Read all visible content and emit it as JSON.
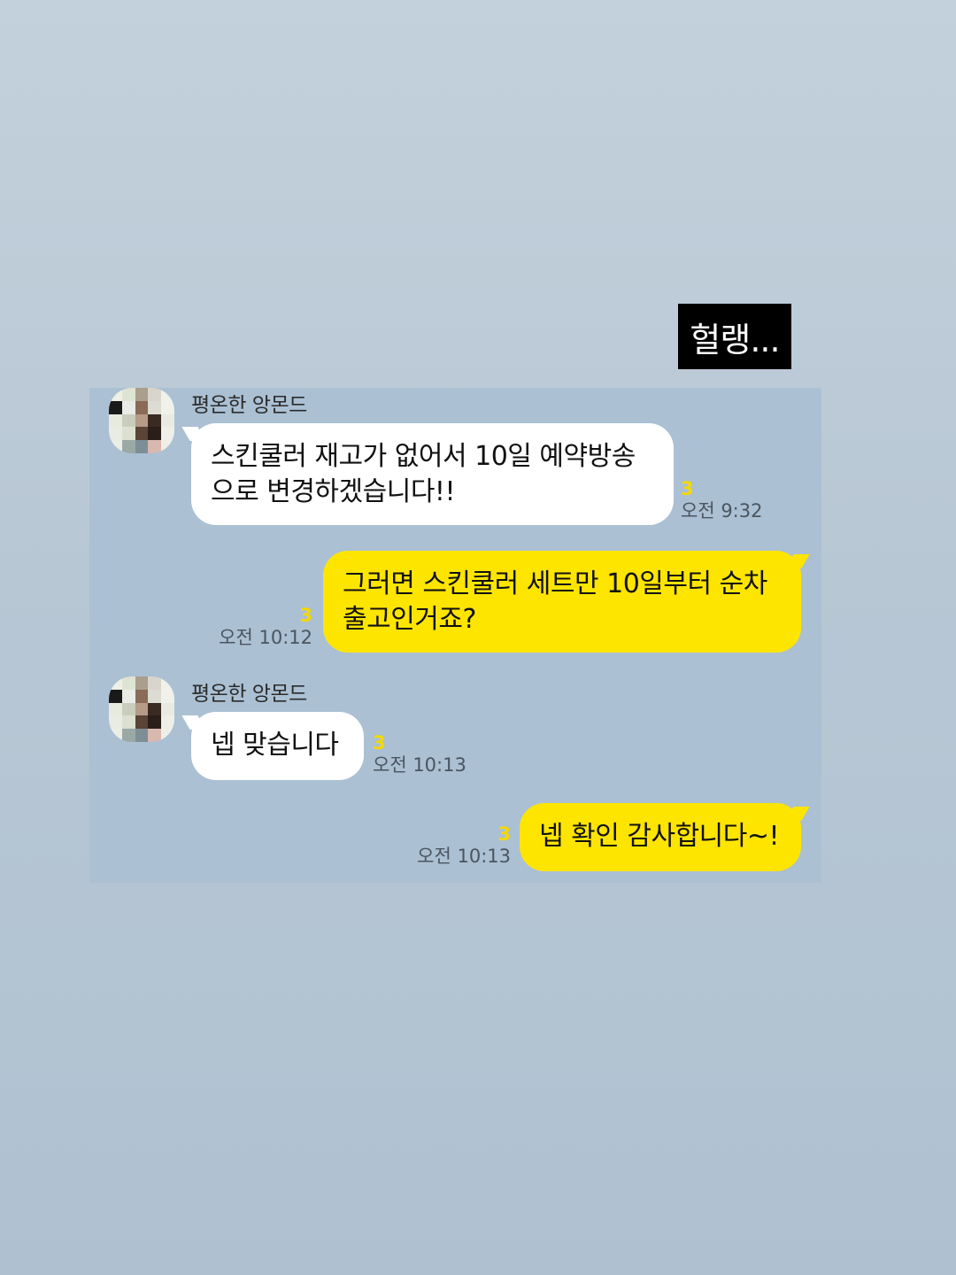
{
  "caption": "헐랭...",
  "colors": {
    "incoming_bubble": "#ffffff",
    "outgoing_bubble": "#fee500",
    "unread_count": "#f5d800",
    "chat_background": "#abc0d3"
  },
  "messages": [
    {
      "direction": "incoming",
      "sender": "평온한 앙몬드",
      "text": "스킨쿨러 재고가 없어서 10일 예약방송\n으로 변경하겠습니다!!",
      "unread": "3",
      "time": "오전 9:32"
    },
    {
      "direction": "outgoing",
      "text": "그러면 스킨쿨러 세트만 10일부터 순차\n출고인거죠?",
      "unread": "3",
      "time": "오전 10:12"
    },
    {
      "direction": "incoming",
      "sender": "평온한 앙몬드",
      "text": "넵 맞습니다",
      "unread": "3",
      "time": "오전 10:13"
    },
    {
      "direction": "outgoing",
      "text": "넵 확인 감사합니다~!",
      "unread": "3",
      "time": "오전 10:13"
    }
  ]
}
